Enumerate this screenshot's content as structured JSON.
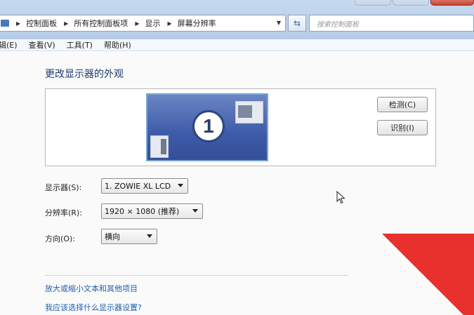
{
  "address_bar": {
    "crumbs": [
      "控制面板",
      "所有控制面板项",
      "显示",
      "屏幕分辨率"
    ],
    "search_placeholder": "搜索控制面板"
  },
  "menu": {
    "items": [
      "辑(E)",
      "查看(V)",
      "工具(T)",
      "帮助(H)"
    ]
  },
  "main": {
    "title": "更改显示器的外观",
    "monitor_number": "1",
    "detect_label": "检测(C)",
    "identify_label": "识别(I)",
    "display_label": "显示器(S):",
    "display_value": "1. ZOWIE XL LCD",
    "resolution_label": "分辨率(R):",
    "resolution_value": "1920 × 1080 (推荐)",
    "orientation_label": "方向(O):",
    "orientation_value": "横向"
  },
  "links": {
    "text_size": "放大或缩小文本和其他项目",
    "which_settings": "我应该选择什么显示器设置?"
  },
  "colors": {
    "accent_red": "#e8302c",
    "link_blue": "#1f5fae"
  }
}
